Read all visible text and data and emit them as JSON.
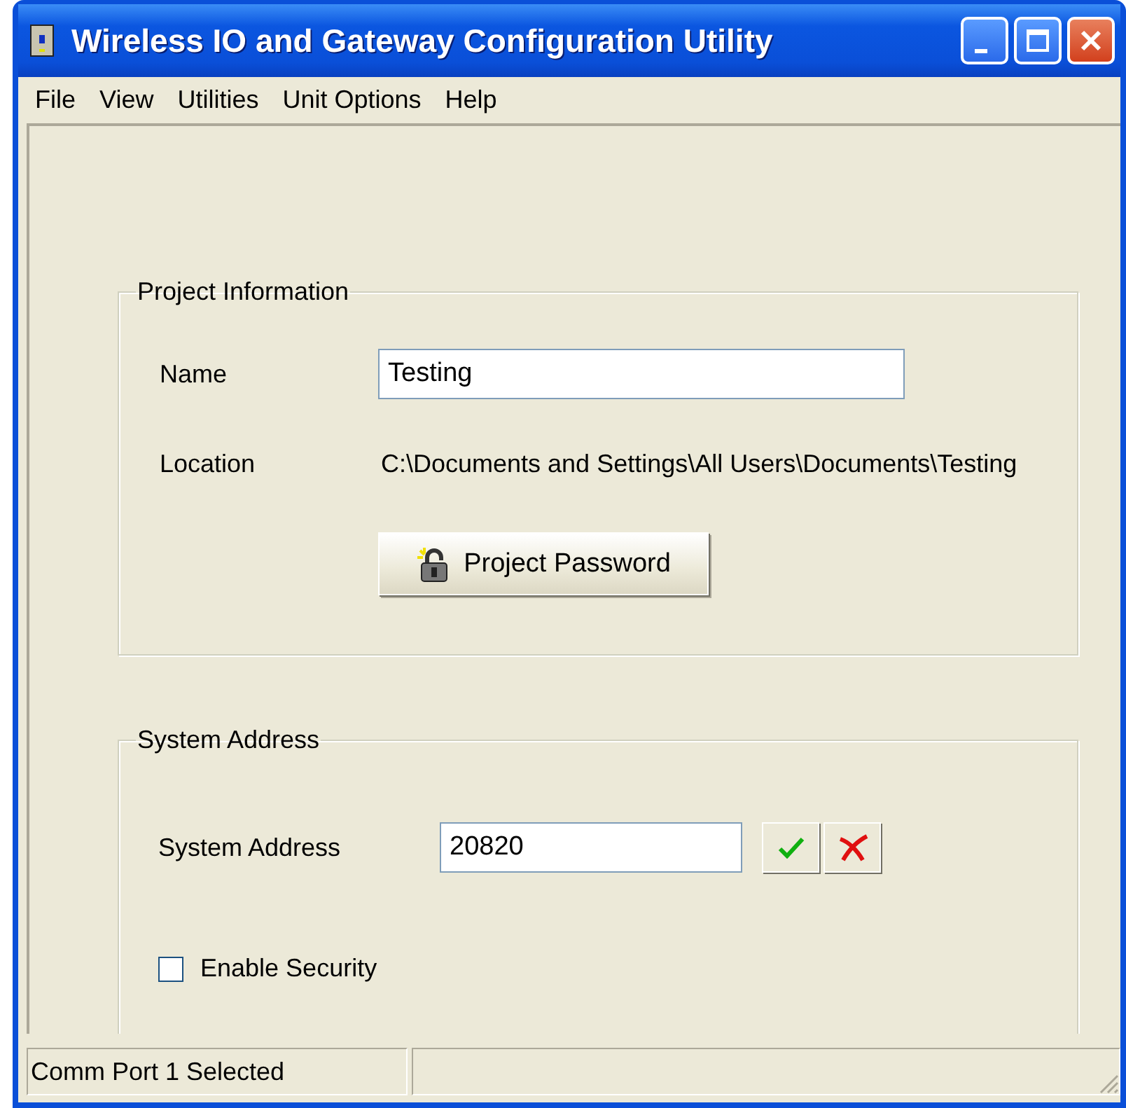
{
  "window": {
    "title": "Wireless IO and Gateway Configuration Utility"
  },
  "menu": [
    "File",
    "View",
    "Utilities",
    "Unit Options",
    "Help"
  ],
  "project_information": {
    "title": "Project Information",
    "name_label": "Name",
    "name_value": "Testing",
    "location_label": "Location",
    "location_value": "C:\\Documents and Settings\\All Users\\Documents\\Testing",
    "password_button": "Project Password"
  },
  "system_address": {
    "title": "System Address",
    "label": "System Address",
    "value": "20820",
    "enable_security": {
      "label": "Enable Security",
      "checked": false
    }
  },
  "status_bar": {
    "message": "Comm Port 1 Selected"
  }
}
